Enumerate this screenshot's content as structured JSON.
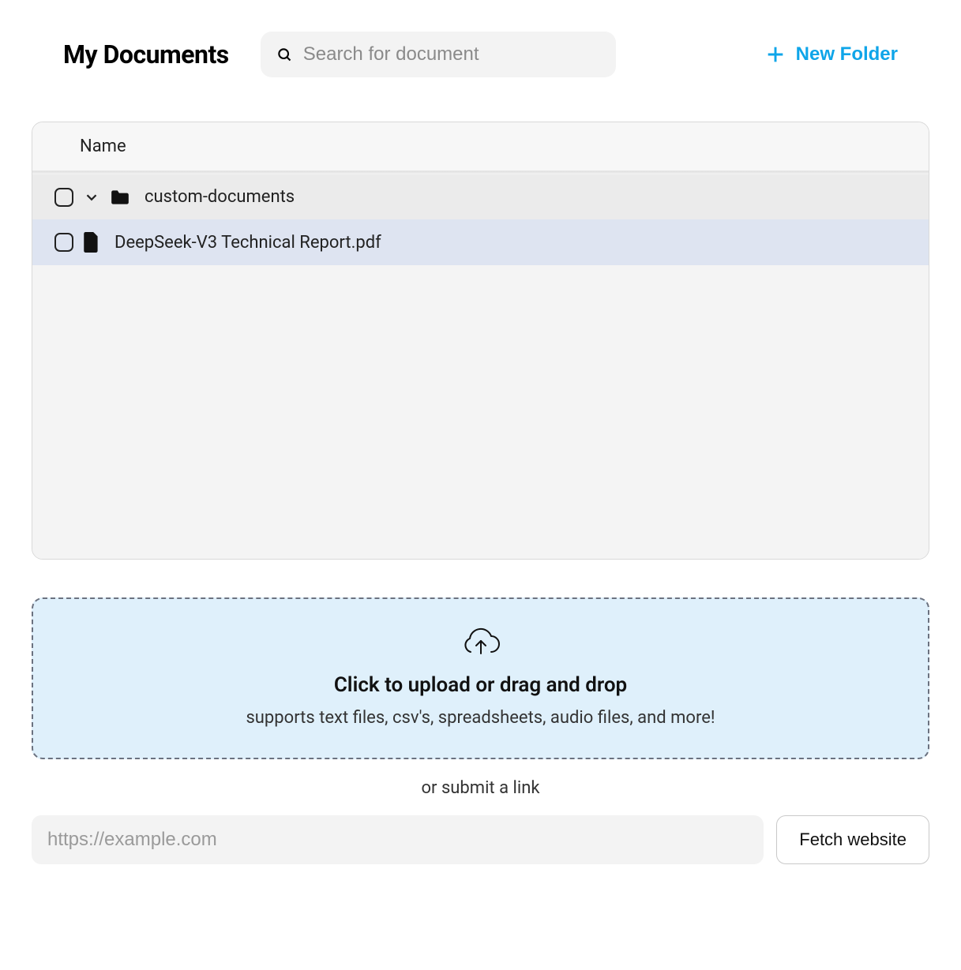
{
  "header": {
    "title": "My Documents",
    "search_placeholder": "Search for document",
    "new_folder_label": "New Folder"
  },
  "table": {
    "column_name": "Name",
    "rows": [
      {
        "type": "folder",
        "label": "custom-documents"
      },
      {
        "type": "file",
        "label": "DeepSeek-V3 Technical Report.pdf"
      }
    ]
  },
  "upload": {
    "title": "Click to upload or drag and drop",
    "subtitle": "supports text files, csv's, spreadsheets, audio files, and more!"
  },
  "link_section": {
    "or_text": "or submit a link",
    "url_placeholder": "https://example.com",
    "fetch_label": "Fetch website"
  }
}
